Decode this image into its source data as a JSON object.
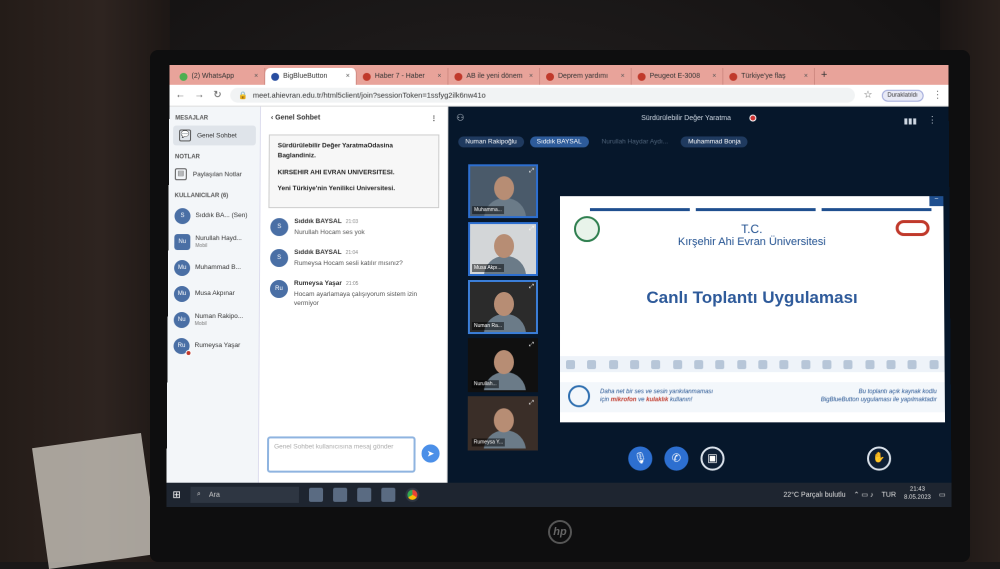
{
  "browser": {
    "tabs": [
      {
        "label": "(2) WhatsApp",
        "icon": "whatsapp-icon"
      },
      {
        "label": "BigBlueButton",
        "icon": "bigbluebutton-icon",
        "active": true
      },
      {
        "label": "Haber 7 - Haber",
        "icon": "news-icon"
      },
      {
        "label": "AB ile yeni dönem",
        "icon": "news-icon"
      },
      {
        "label": "Deprem yardımı",
        "icon": "news-icon"
      },
      {
        "label": "Peugeot E-3008",
        "icon": "news-icon"
      },
      {
        "label": "Türkiye'ye flaş",
        "icon": "news-icon"
      }
    ],
    "url": "meet.ahievran.edu.tr/html5client/join?sessionToken=1ssfyg2ilk6nw41o",
    "profile_label": "Duraklatıldı"
  },
  "sidebar": {
    "messages_header": "MESAJLAR",
    "public_chat": "Genel Sohbet",
    "notes_header": "NOTLAR",
    "shared_notes": "Paylaşılan Notlar",
    "users_header": "KULLANICILAR (6)",
    "users": [
      {
        "initials": "S",
        "name": "Sıddık BA... (Sen)",
        "sub": ""
      },
      {
        "initials": "Nu",
        "name": "Nurullah Hayd...",
        "sub": "Mobil"
      },
      {
        "initials": "Mu",
        "name": "Muhammad B...",
        "sub": ""
      },
      {
        "initials": "Mu",
        "name": "Musa Akpınar",
        "sub": ""
      },
      {
        "initials": "Nu",
        "name": "Numan Rakipo...",
        "sub": "Mobil"
      },
      {
        "initials": "Ru",
        "name": "Rumeysa Yaşar",
        "sub": ""
      }
    ]
  },
  "chat": {
    "title": "Genel Sohbet",
    "welcome": [
      "Sürdürülebilir Değer YaratmaOdasina Baglandiniz.",
      "KIRSEHIR AHI EVRAN UNIVERSITESI.",
      "Yeni Türkiye'nin Yenilikci Universitesi."
    ],
    "messages": [
      {
        "initials": "S",
        "name": "Sıddık BAYSAL",
        "time": "21:03",
        "text": "Nurullah Hocam ses yok"
      },
      {
        "initials": "S",
        "name": "Sıddık BAYSAL",
        "time": "21:04",
        "text": "Rumeysa Hocam sesli katılır mısınız?"
      },
      {
        "initials": "Ru",
        "name": "Rumeysa Yaşar",
        "time": "21:05",
        "text": "Hocam ayarlamaya çalışıyorum sistem izin vermiyor"
      }
    ],
    "input_placeholder": "Genel Sohbet kullanıcısına mesaj gönder"
  },
  "meeting": {
    "title": "Sürdürülebilir Değer Yaratma",
    "talkers": [
      {
        "name": "Numan Rakipoğlu",
        "state": "normal"
      },
      {
        "name": "Sıddık BAYSAL",
        "state": "active"
      },
      {
        "name": "Nurullah Haydar Aydı...",
        "state": "faded"
      },
      {
        "name": "Muhammad Bonja",
        "state": "normal"
      }
    ],
    "cameras": [
      {
        "label": "Muhamma..."
      },
      {
        "label": "Musa Akpı..."
      },
      {
        "label": "Numan Ra..."
      },
      {
        "label": "Nurullah..."
      },
      {
        "label": "Rumeysa Y..."
      }
    ],
    "slide": {
      "line1": "T.C.",
      "line2": "Kırşehir Ahi Evran Üniversitesi",
      "main": "Canlı Toplantı Uygulaması",
      "footer_left_1": "Daha net bir ses ve sesin yankılanmaması",
      "footer_left_2a": "için ",
      "footer_left_2b": "mikrofon",
      "footer_left_2c": " ve ",
      "footer_left_2d": "kulaklık",
      "footer_left_2e": " kullanın!",
      "footer_right_1": "Bu toplantı açık kaynak kodlu",
      "footer_right_2": "BigBlueButton uygulaması ile yapılmaktadır"
    }
  },
  "taskbar": {
    "search_label": "Ara",
    "weather": "22°C  Parçalı bulutlu",
    "lang": "TUR",
    "time": "21:43",
    "date": "8.05.2023"
  }
}
